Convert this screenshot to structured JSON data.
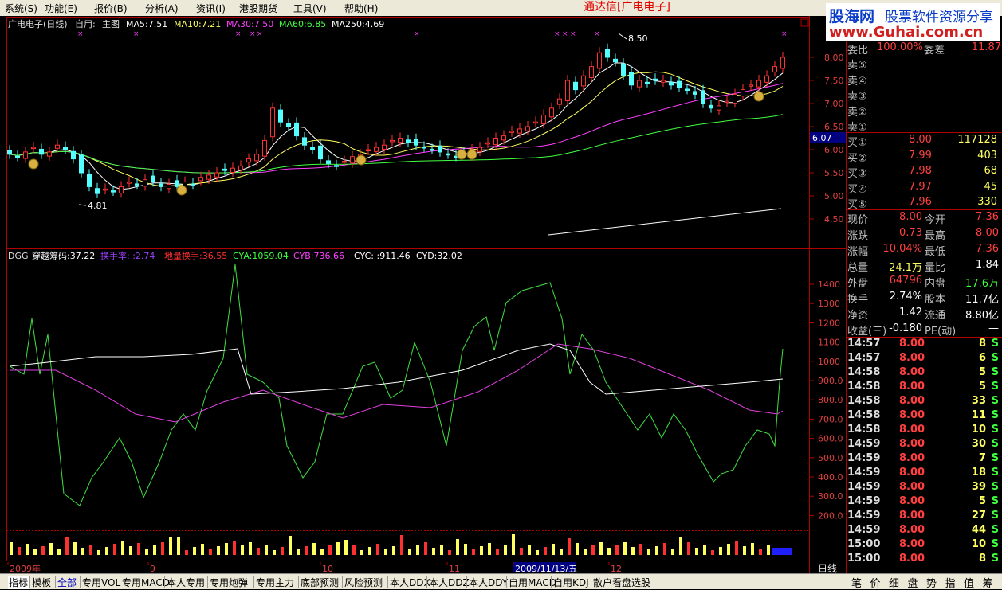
{
  "menu": [
    {
      "label": "系统(S)"
    },
    {
      "label": "功能(E)"
    },
    {
      "label": "报价(B)"
    },
    {
      "label": "分析(A)"
    },
    {
      "label": "资讯(I)"
    },
    {
      "label": "港股期货"
    },
    {
      "label": "工具(V)"
    },
    {
      "label": "帮助(H)"
    }
  ],
  "app": {
    "name": "通达信",
    "stock_bracket": "[广电电子]"
  },
  "logo": {
    "site": "股海网",
    "slogan": "股票软件资源分享",
    "url": "www.Guhai.com.cn"
  },
  "main_chart": {
    "title": "广电电子(日线)",
    "scheme": "自用:",
    "view": "主图",
    "ma": [
      {
        "label": "MA5:7.51",
        "color": "#ffffff"
      },
      {
        "label": "MA10:7.21",
        "color": "#ffff60"
      },
      {
        "label": "MA30:7.50",
        "color": "#ff40ff"
      },
      {
        "label": "MA60:6.85",
        "color": "#40ff40"
      },
      {
        "label": "MA250:4.69",
        "color": "#ffffff"
      }
    ],
    "high_marker": "8.50",
    "low_marker": "4.81",
    "price_tag": "6.07",
    "y_ticks": [
      "8.00",
      "7.50",
      "7.00",
      "6.50",
      "6.00",
      "5.50",
      "5.00",
      "4.50"
    ]
  },
  "indicator": {
    "name": "DGG",
    "labels": [
      {
        "text": "穿越筹码:37.22",
        "color": "#ffffff"
      },
      {
        "text": "换手率: :2.74",
        "color": "#a040ff"
      },
      {
        "text": "地量换手:36.55",
        "color": "#ff3030"
      },
      {
        "text": "CYA:1059.04",
        "color": "#40ff40"
      },
      {
        "text": "CYB:736.66",
        "color": "#ff40ff"
      },
      {
        "text": "CYC: :911.46",
        "color": "#ffffff"
      },
      {
        "text": "CYD:32.02",
        "color": "#ffffff"
      }
    ],
    "y_ticks": [
      "1400",
      "1300",
      "1200",
      "1100",
      "1000",
      "900.0",
      "800.0",
      "700.0",
      "600.0",
      "500.0",
      "400.0",
      "300.0",
      "200.0"
    ]
  },
  "x_axis": {
    "labels": [
      "2009年",
      "9",
      "10",
      "11",
      "2009/11/13/五",
      "12"
    ],
    "period": "日线"
  },
  "quote": {
    "top_row": {
      "label": "委比",
      "value": "100.00%",
      "label2": "委差",
      "value2": "11.87"
    },
    "sells": [
      {
        "label": "卖⑤"
      },
      {
        "label": "卖④"
      },
      {
        "label": "卖③"
      },
      {
        "label": "卖②"
      },
      {
        "label": "卖①"
      }
    ],
    "buys": [
      {
        "label": "买①",
        "price": "8.00",
        "vol": "117128"
      },
      {
        "label": "买②",
        "price": "7.99",
        "vol": "403"
      },
      {
        "label": "买③",
        "price": "7.98",
        "vol": "68"
      },
      {
        "label": "买④",
        "price": "7.97",
        "vol": "45"
      },
      {
        "label": "买⑤",
        "price": "7.96",
        "vol": "330"
      }
    ],
    "stats": [
      {
        "l1": "现价",
        "v1": "8.00",
        "c1": "#ff4040",
        "l2": "今开",
        "v2": "7.36",
        "c2": "#ff4040"
      },
      {
        "l1": "涨跌",
        "v1": "0.73",
        "c1": "#ff4040",
        "l2": "最高",
        "v2": "8.00",
        "c2": "#ff4040"
      },
      {
        "l1": "涨幅",
        "v1": "10.04%",
        "c1": "#ff4040",
        "l2": "最低",
        "v2": "7.36",
        "c2": "#ff4040"
      },
      {
        "l1": "总量",
        "v1": "24.1万",
        "c1": "#ffff60",
        "l2": "量比",
        "v2": "1.84",
        "c2": "#ffffff"
      },
      {
        "l1": "外盘",
        "v1": "64796",
        "c1": "#ff4040",
        "l2": "内盘",
        "v2": "17.6万",
        "c2": "#40ff40"
      },
      {
        "l1": "换手",
        "v1": "2.74%",
        "c1": "#ffffff",
        "l2": "股本",
        "v2": "11.7亿",
        "c2": "#ffffff"
      },
      {
        "l1": "净资",
        "v1": "1.42",
        "c1": "#ffffff",
        "l2": "流通",
        "v2": "8.80亿",
        "c2": "#ffffff"
      },
      {
        "l1": "收益(三)",
        "v1": "-0.180",
        "c1": "#ffffff",
        "l2": "PE(动)",
        "v2": "—",
        "c2": "#ffffff"
      }
    ],
    "ticks": [
      {
        "time": "14:57",
        "price": "8.00",
        "vol": "8",
        "side": "S"
      },
      {
        "time": "14:57",
        "price": "8.00",
        "vol": "6",
        "side": "S"
      },
      {
        "time": "14:58",
        "price": "8.00",
        "vol": "5",
        "side": "S"
      },
      {
        "time": "14:58",
        "price": "8.00",
        "vol": "5",
        "side": "S"
      },
      {
        "time": "14:58",
        "price": "8.00",
        "vol": "33",
        "side": "S"
      },
      {
        "time": "14:58",
        "price": "8.00",
        "vol": "11",
        "side": "S"
      },
      {
        "time": "14:58",
        "price": "8.00",
        "vol": "10",
        "side": "S"
      },
      {
        "time": "14:59",
        "price": "8.00",
        "vol": "30",
        "side": "S"
      },
      {
        "time": "14:59",
        "price": "8.00",
        "vol": "7",
        "side": "S"
      },
      {
        "time": "14:59",
        "price": "8.00",
        "vol": "18",
        "side": "S"
      },
      {
        "time": "14:59",
        "price": "8.00",
        "vol": "39",
        "side": "S"
      },
      {
        "time": "14:59",
        "price": "8.00",
        "vol": "5",
        "side": "S"
      },
      {
        "time": "14:59",
        "price": "8.00",
        "vol": "27",
        "side": "S"
      },
      {
        "time": "14:59",
        "price": "8.00",
        "vol": "44",
        "side": "S"
      },
      {
        "time": "15:00",
        "price": "8.00",
        "vol": "10",
        "side": "S"
      },
      {
        "time": "15:00",
        "price": "8.00",
        "vol": "8",
        "side": "S"
      }
    ]
  },
  "tabs": [
    {
      "label": "指标"
    },
    {
      "label": "模板"
    },
    {
      "label": "全部"
    },
    {
      "label": "专用VOL"
    },
    {
      "label": "专用MACD"
    },
    {
      "label": "本人专用"
    },
    {
      "label": "专用炮弹"
    },
    {
      "label": "专用主力"
    },
    {
      "label": "底部预测"
    },
    {
      "label": "风险预测"
    },
    {
      "label": "本人DDX"
    },
    {
      "label": "本人DDZ"
    },
    {
      "label": "本人DDY"
    },
    {
      "label": "自用MACD"
    },
    {
      "label": "自用KDJ"
    },
    {
      "label": "散户看盘选股"
    }
  ],
  "right_tabs": [
    {
      "label": "笔"
    },
    {
      "label": "价"
    },
    {
      "label": "细"
    },
    {
      "label": "盘"
    },
    {
      "label": "势"
    },
    {
      "label": "指"
    },
    {
      "label": "值"
    },
    {
      "label": "筹"
    }
  ],
  "colors": {
    "up": "#ff3232",
    "down": "#54ffff",
    "axis": "#b00000",
    "bg": "#000000"
  }
}
